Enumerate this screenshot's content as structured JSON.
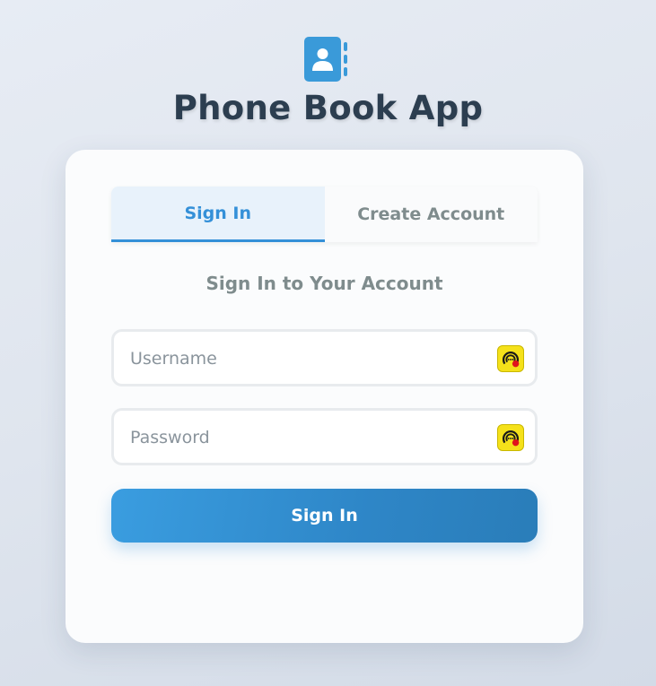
{
  "app": {
    "title": "Phone Book App",
    "logo_icon": "contact-book-icon",
    "accent_color": "#3490d8"
  },
  "tabs": [
    {
      "label": "Sign In",
      "active": true
    },
    {
      "label": "Create Account",
      "active": false
    }
  ],
  "form": {
    "heading": "Sign In to Your Account",
    "username": {
      "placeholder": "Username",
      "value": "",
      "icon": "password-manager-icon"
    },
    "password": {
      "placeholder": "Password",
      "value": "",
      "icon": "password-manager-icon"
    },
    "submit_label": "Sign In"
  }
}
